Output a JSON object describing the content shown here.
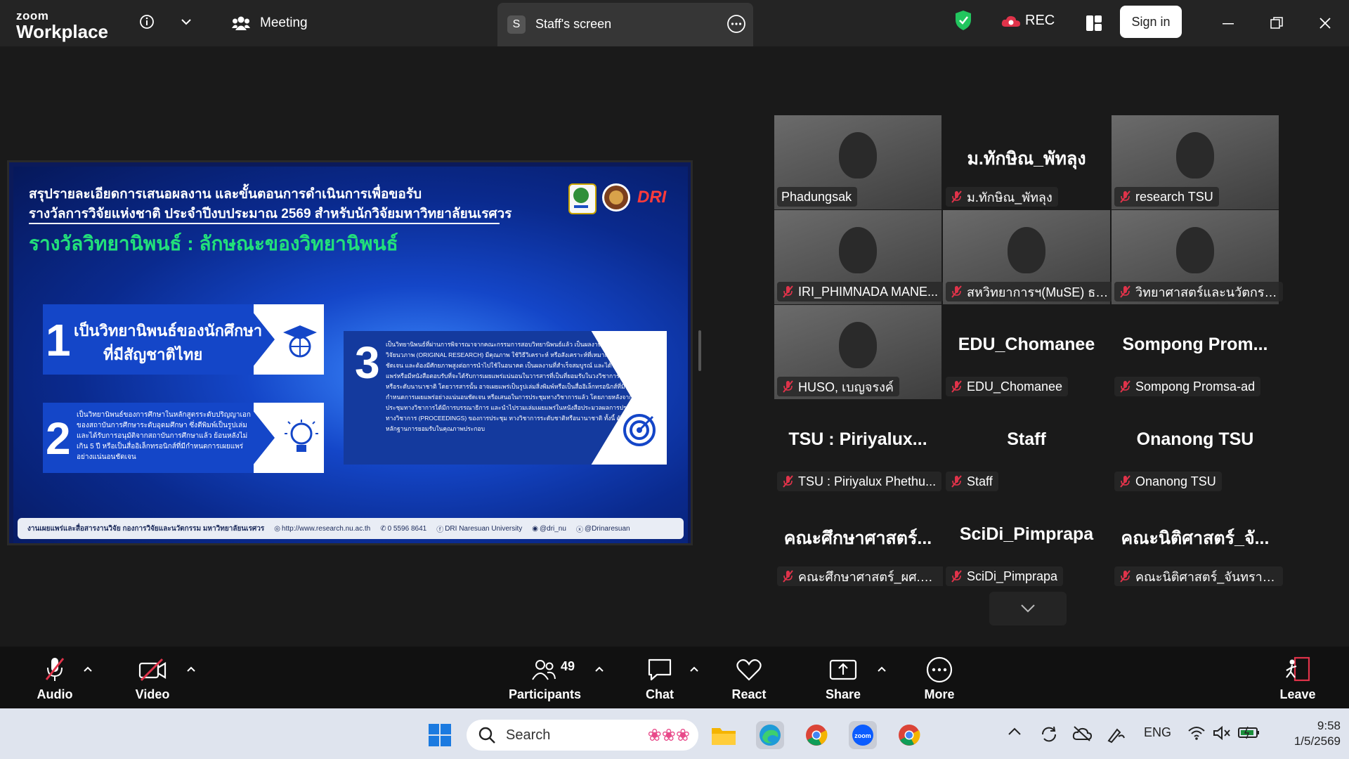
{
  "app": {
    "logo_line1": "zoom",
    "logo_line2": "Workplace",
    "meeting_label": "Meeting",
    "share_tab_badge": "S",
    "share_tab_label": "Staff's screen",
    "rec_label": "REC",
    "signin_label": "Sign in"
  },
  "slide": {
    "title_line1": "สรุปรายละเอียดการเสนอผลงาน และขั้นตอนการดำเนินการเพื่อขอรับ",
    "title_line2": "รางวัลการวิจัยแห่งชาติ ประจำปีงบประมาณ 2569 สำหรับนักวิจัยมหาวิทยาลัยนเรศวร",
    "subtitle": "รางวัลวิทยานิพนธ์ : ลักษณะของวิทยานิพนธ์",
    "logo_text": "DRI",
    "card1": {
      "num": "1",
      "line1": "เป็นวิทยานิพนธ์ของนักศึกษา",
      "line2": "ที่มีสัญชาติไทย"
    },
    "card2": {
      "num": "2",
      "text": "เป็นวิทยานิพนธ์ของการศึกษาในหลักสูตรระดับปริญญาเอกของสถาบันการศึกษาระดับอุดมศึกษา ซึ่งตีพิมพ์เป็นรูปเล่มและได้รับการอนุมัติจากสถาบันการศึกษาแล้ว ย้อนหลังไม่เกิน 5 ปี หรือเป็นสื่ออิเล็กทรอนิกส์ที่มีกำหนดการเผยแพร่อย่างแน่นอนชัดเจน"
    },
    "card3": {
      "num": "3",
      "text": "เป็นวิทยานิพนธ์ที่ผ่านการพิจารณาจากคณะกรรมการสอบวิทยานิพนธ์แล้ว เป็นผลงานที่แสดงผลการวิจัยนวภาพ (ORIGINAL RESEARCH) มีคุณภาพ ใช้วิธีวิเคราะห์ หรือสังเคราะห์ที่เหมาะสมมีความชัดเจน และต้องมีศักยภาพสูงต่อการนำไปใช้ในอนาคต เป็นผลงานที่สำเร็จสมบูรณ์ และได้รับการเผยแพร่หรือมีหนังสือตอบรับที่จะได้รับการเผยแพร่แน่นอนในวารสารที่เป็นที่ยอมรับในวงวิชาการระดับชาติหรือระดับนานาชาติ โดยวารสารนั้น อาจเผยแพร่เป็นรูปเล่มสิ่งพิมพ์หรือเป็นสื่ออิเล็กทรอนิกส์ที่มีกำหนดการเผยแพร่อย่างแน่นอนชัดเจน หรือเสนอในการประชุมทางวิชาการแล้ว โดยภายหลังจากการประชุมทางวิชาการได้มีการบรรณาธิการ และนำไปรวมเล่มเผยแพร่ในหนังสือประมวลผลการประชุมทางวิชาการ (PROCEEDINGS) ของการประชุม ทางวิชาการระดับชาติหรือนานาชาติ ทั้งนี้ ต้องแสดงหลักฐานการยอมรับในคุณภาพประกอบ"
    },
    "footer": {
      "unit": "งานเผยแพร่และสื่อสารงานวิจัย กองการวิจัยและนวัตกรรม มหาวิทยาลัยนเรศวร",
      "web": "http://www.research.nu.ac.th",
      "phone": "0 5596 8641",
      "facebook": "DRI Naresuan University",
      "line": "@dri_nu",
      "x": "@Drinaresuan"
    }
  },
  "participants": [
    {
      "big": "",
      "tag": "Phadungsak",
      "muted": false,
      "video": true,
      "active": true
    },
    {
      "big": "ม.ทักษิณ_พัทลุง",
      "tag": "ม.ทักษิณ_พัทลุง",
      "muted": true,
      "video": false
    },
    {
      "big": "",
      "tag": "research TSU",
      "muted": true,
      "video": true
    },
    {
      "big": "",
      "tag": "IRI_PHIMNADA MANE...",
      "muted": true,
      "video": true
    },
    {
      "big": "",
      "tag": "สหวิทยาการฯ(MuSE) ธน...",
      "muted": true,
      "video": true
    },
    {
      "big": "",
      "tag": "วิทยาศาสตร์และนวัตกรรม...",
      "muted": true,
      "video": true
    },
    {
      "big": "",
      "tag": "HUSO, เบญจรงค์",
      "muted": true,
      "video": true
    },
    {
      "big": "EDU_Chomanee",
      "tag": "EDU_Chomanee",
      "muted": true,
      "video": false
    },
    {
      "big": "Sompong  Prom...",
      "tag": "Sompong Promsa-ad",
      "muted": true,
      "video": false
    },
    {
      "big": "TSU : Piriyalux...",
      "tag": "TSU : Piriyalux Phethu...",
      "muted": true,
      "video": false
    },
    {
      "big": "Staff",
      "tag": "Staff",
      "muted": true,
      "video": false
    },
    {
      "big": "Onanong TSU",
      "tag": "Onanong TSU",
      "muted": true,
      "video": false
    },
    {
      "big": "คณะศึกษาศาสตร์...",
      "tag": "คณะศึกษาศาสตร์_ผศ.ดร....",
      "muted": true,
      "video": false
    },
    {
      "big": "SciDi_Pimprapa",
      "tag": "SciDi_Pimprapa",
      "muted": true,
      "video": false
    },
    {
      "big": "คณะนิติศาสตร์_จั...",
      "tag": "คณะนิติศาสตร์_จันทราทิพ...",
      "muted": true,
      "video": false
    }
  ],
  "toolbar": {
    "audio": "Audio",
    "video": "Video",
    "participants": "Participants",
    "participant_count": "49",
    "chat": "Chat",
    "react": "React",
    "share": "Share",
    "more": "More",
    "leave": "Leave"
  },
  "taskbar": {
    "search_placeholder": "Search",
    "lang": "ENG",
    "time": "9:58",
    "date": "1/5/2569"
  },
  "colors": {
    "accent_green": "#3ddc84",
    "record_red": "#e0334a",
    "slide_green": "#22e07a"
  }
}
